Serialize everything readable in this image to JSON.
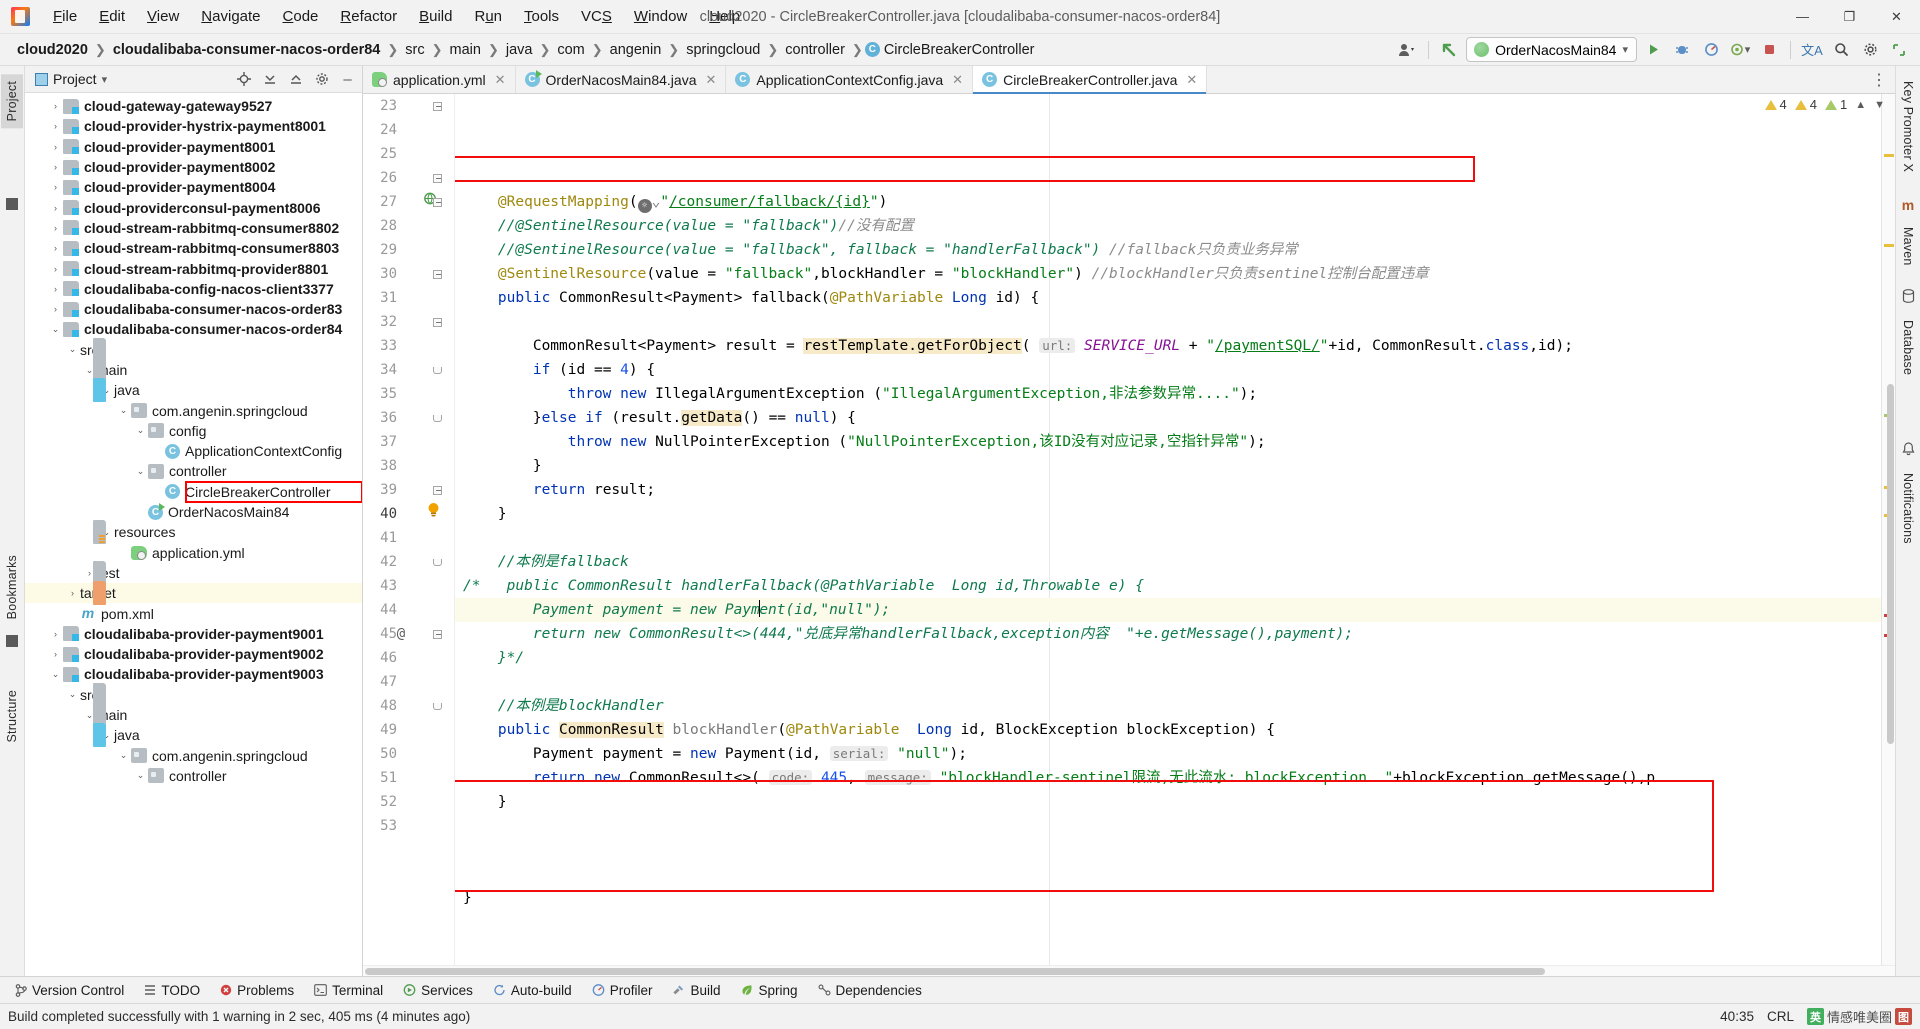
{
  "window": {
    "title": "cloud2020 - CircleBreakerController.java [cloudalibaba-consumer-nacos-order84]",
    "minimize": "—",
    "maximize": "❐",
    "close": "✕"
  },
  "menubar": [
    {
      "label": "File"
    },
    {
      "label": "Edit"
    },
    {
      "label": "View"
    },
    {
      "label": "Navigate"
    },
    {
      "label": "Code"
    },
    {
      "label": "Refactor"
    },
    {
      "label": "Build"
    },
    {
      "label": "Run"
    },
    {
      "label": "Tools"
    },
    {
      "label": "VCS"
    },
    {
      "label": "Window"
    },
    {
      "label": "Help"
    }
  ],
  "breadcrumbs": [
    {
      "label": "cloud2020",
      "bold": true
    },
    {
      "label": "cloudalibaba-consumer-nacos-order84",
      "bold": true
    },
    {
      "label": "src"
    },
    {
      "label": "main"
    },
    {
      "label": "java"
    },
    {
      "label": "com"
    },
    {
      "label": "angenin"
    },
    {
      "label": "springcloud"
    },
    {
      "label": "controller"
    },
    {
      "label": "CircleBreakerController",
      "icon": "C"
    }
  ],
  "toolbar_right": {
    "user_icon": "user-icon",
    "back_arrow": "↖",
    "run_config": "OrderNacosMain84",
    "run": "▶",
    "debug": "debug-icon",
    "profile": "profile-icon",
    "coverage": "coverage-icon",
    "stop": "■",
    "translate": "文A",
    "search": "⚲",
    "settings": "⚙"
  },
  "left_rail": [
    {
      "label": "Project",
      "selected": true
    },
    {
      "label": "Bookmarks",
      "selected": false
    },
    {
      "label": "Structure",
      "selected": false
    }
  ],
  "right_rail": [
    {
      "label": "Key Promoter X"
    },
    {
      "label": "Maven"
    },
    {
      "label": "Database"
    },
    {
      "label": "Notifications"
    }
  ],
  "project_panel": {
    "title": "Project",
    "dropdown": "▾",
    "actions": [
      "locate-icon",
      "expand-all-icon",
      "collapse-all-icon",
      "settings-icon",
      "hide-icon"
    ],
    "tree": [
      {
        "indent": 1,
        "arrow": "›",
        "icon": "mod",
        "label": "cloud-gateway-gateway9527",
        "bold": true
      },
      {
        "indent": 1,
        "arrow": "›",
        "icon": "mod",
        "label": "cloud-provider-hystrix-payment8001",
        "bold": true
      },
      {
        "indent": 1,
        "arrow": "›",
        "icon": "mod",
        "label": "cloud-provider-payment8001",
        "bold": true
      },
      {
        "indent": 1,
        "arrow": "›",
        "icon": "mod",
        "label": "cloud-provider-payment8002",
        "bold": true
      },
      {
        "indent": 1,
        "arrow": "›",
        "icon": "mod",
        "label": "cloud-provider-payment8004",
        "bold": true
      },
      {
        "indent": 1,
        "arrow": "›",
        "icon": "mod",
        "label": "cloud-providerconsul-payment8006",
        "bold": true
      },
      {
        "indent": 1,
        "arrow": "›",
        "icon": "mod",
        "label": "cloud-stream-rabbitmq-consumer8802",
        "bold": true
      },
      {
        "indent": 1,
        "arrow": "›",
        "icon": "mod",
        "label": "cloud-stream-rabbitmq-consumer8803",
        "bold": true
      },
      {
        "indent": 1,
        "arrow": "›",
        "icon": "mod",
        "label": "cloud-stream-rabbitmq-provider8801",
        "bold": true
      },
      {
        "indent": 1,
        "arrow": "›",
        "icon": "mod",
        "label": "cloudalibaba-config-nacos-client3377",
        "bold": true
      },
      {
        "indent": 1,
        "arrow": "›",
        "icon": "mod",
        "label": "cloudalibaba-consumer-nacos-order83",
        "bold": true
      },
      {
        "indent": 1,
        "arrow": "⌄",
        "icon": "mod",
        "label": "cloudalibaba-consumer-nacos-order84",
        "bold": true
      },
      {
        "indent": 2,
        "arrow": "⌄",
        "icon": "fold",
        "label": "src"
      },
      {
        "indent": 3,
        "arrow": "⌄",
        "icon": "fold",
        "label": "main"
      },
      {
        "indent": 4,
        "arrow": "⌄",
        "icon": "foldblue",
        "label": "java"
      },
      {
        "indent": 5,
        "arrow": "⌄",
        "icon": "pkg",
        "label": "com.angenin.springcloud"
      },
      {
        "indent": 6,
        "arrow": "⌄",
        "icon": "pkg",
        "label": "config"
      },
      {
        "indent": 7,
        "arrow": "",
        "icon": "cls",
        "label": "ApplicationContextConfig"
      },
      {
        "indent": 6,
        "arrow": "⌄",
        "icon": "pkg",
        "label": "controller"
      },
      {
        "indent": 7,
        "arrow": "",
        "icon": "cls",
        "label": "CircleBreakerController",
        "boxed": true
      },
      {
        "indent": 6,
        "arrow": "",
        "icon": "clsrun",
        "label": "OrderNacosMain84"
      },
      {
        "indent": 4,
        "arrow": "⌄",
        "icon": "foldres",
        "label": "resources"
      },
      {
        "indent": 5,
        "arrow": "",
        "icon": "yml",
        "label": "application.yml"
      },
      {
        "indent": 3,
        "arrow": "›",
        "icon": "fold",
        "label": "test"
      },
      {
        "indent": 2,
        "arrow": "›",
        "icon": "foldorange",
        "label": "target",
        "highlight": true
      },
      {
        "indent": 2,
        "arrow": "",
        "icon": "mvn",
        "label": "pom.xml"
      },
      {
        "indent": 1,
        "arrow": "›",
        "icon": "mod",
        "label": "cloudalibaba-provider-payment9001",
        "bold": true
      },
      {
        "indent": 1,
        "arrow": "›",
        "icon": "mod",
        "label": "cloudalibaba-provider-payment9002",
        "bold": true
      },
      {
        "indent": 1,
        "arrow": "⌄",
        "icon": "mod",
        "label": "cloudalibaba-provider-payment9003",
        "bold": true
      },
      {
        "indent": 2,
        "arrow": "⌄",
        "icon": "fold",
        "label": "src"
      },
      {
        "indent": 3,
        "arrow": "⌄",
        "icon": "fold",
        "label": "main"
      },
      {
        "indent": 4,
        "arrow": "⌄",
        "icon": "foldblue",
        "label": "java"
      },
      {
        "indent": 5,
        "arrow": "⌄",
        "icon": "pkg",
        "label": "com.angenin.springcloud"
      },
      {
        "indent": 6,
        "arrow": "⌄",
        "icon": "pkg",
        "label": "controller"
      }
    ]
  },
  "editor_tabs": [
    {
      "label": "application.yml",
      "icon": "yml",
      "active": false
    },
    {
      "label": "OrderNacosMain84.java",
      "icon": "clsrun",
      "active": false
    },
    {
      "label": "ApplicationContextConfig.java",
      "icon": "cls",
      "active": false
    },
    {
      "label": "CircleBreakerController.java",
      "icon": "cls",
      "active": true
    }
  ],
  "inspection": {
    "errors_icon": "warning-triangle",
    "counts": [
      "4",
      "4",
      "1"
    ],
    "chevron_up": "⌃",
    "chevron_down": "⌄"
  },
  "code": {
    "first_line": 23,
    "lines": [
      {
        "n": 23,
        "fold": "open"
      },
      {
        "n": 24
      },
      {
        "n": 25
      },
      {
        "n": 26,
        "fold": "open"
      },
      {
        "n": 27,
        "mark": "globe-run",
        "fold": "open"
      },
      {
        "n": 28
      },
      {
        "n": 29
      },
      {
        "n": 30,
        "fold": "open"
      },
      {
        "n": 31
      },
      {
        "n": 32,
        "fold": "open"
      },
      {
        "n": 33
      },
      {
        "n": 34,
        "fold": "close"
      },
      {
        "n": 35
      },
      {
        "n": 36,
        "fold": "close"
      },
      {
        "n": 37
      },
      {
        "n": 38
      },
      {
        "n": 39,
        "fold": "open"
      },
      {
        "n": 40,
        "mark": "bulb",
        "current": true
      },
      {
        "n": 41
      },
      {
        "n": 42,
        "fold": "close"
      },
      {
        "n": 43
      },
      {
        "n": 44
      },
      {
        "n": 45,
        "mark": "@",
        "fold": "open"
      },
      {
        "n": 46
      },
      {
        "n": 47
      },
      {
        "n": 48,
        "fold": "close"
      },
      {
        "n": 49
      },
      {
        "n": 50
      },
      {
        "n": 51
      },
      {
        "n": 52
      },
      {
        "n": 53
      }
    ],
    "text": {
      "l23": "@RequestMapping(ⓧ⌄\"/consumer/fallback/{id}\")",
      "l24": "//@SentinelResource(value = \"fallback\")//没有配置",
      "l25": "//@SentinelResource(value = \"fallback\", fallback = \"handlerFallback\") //fallback只负责业务异常",
      "l26": "@SentinelResource(value = \"fallback\",blockHandler = \"blockHandler\") //blockHandler只负责sentinel控制台配置违章",
      "l27": "public CommonResult<Payment> fallback(@PathVariable Long id) {",
      "l29": "CommonResult<Payment> result = restTemplate.getForObject( url: SERVICE_URL + \"/paymentSQL/\"+id, CommonResult.class,id);",
      "l30": "if (id == 4) {",
      "l31": "throw new IllegalArgumentException (\"IllegalArgumentException,非法参数异常....\");",
      "l32": "}else if (result.getData() == null) {",
      "l33": "throw new NullPointerException (\"NullPointerException,该ID没有对应记录,空指针异常\");",
      "l34": "}",
      "l35": "return result;",
      "l36": "}",
      "l38": "//本例是fallback",
      "l39": "/*   public CommonResult handlerFallback(@PathVariable  Long id,Throwable e) {",
      "l40": "Payment payment = new Payment(id,\"null\");",
      "l41": "return new CommonResult<>(444,\"兜底异常handlerFallback,exception内容  \"+e.getMessage(),payment);",
      "l42": "}*/",
      "l44": "//本例是blockHandler",
      "l45": "public CommonResult blockHandler(@PathVariable  Long id, BlockException blockException) {",
      "l46": "Payment payment = new Payment(id, serial: \"null\");",
      "l47": "return new CommonResult<>( code: 445, message: \"blockHandler-sentinel限流,无此流水: blockException  \"+blockException.getMessage(),p",
      "l48": "}",
      "l52": "}"
    }
  },
  "bottom_tools": [
    {
      "label": "Version Control",
      "icon": "branch-icon"
    },
    {
      "label": "TODO",
      "icon": "list-icon"
    },
    {
      "label": "Problems",
      "icon": "error-icon"
    },
    {
      "label": "Terminal",
      "icon": "terminal-icon"
    },
    {
      "label": "Services",
      "icon": "services-icon"
    },
    {
      "label": "Auto-build",
      "icon": "refresh-icon"
    },
    {
      "label": "Profiler",
      "icon": "gauge-icon"
    },
    {
      "label": "Build",
      "icon": "hammer-icon"
    },
    {
      "label": "Spring",
      "icon": "leaf-icon"
    },
    {
      "label": "Dependencies",
      "icon": "dependencies-icon"
    }
  ],
  "statusbar": {
    "message": "Build completed successfully with 1 warning in 2 sec, 405 ms (4 minutes ago)",
    "caret": "40:35",
    "line_sep": "CRL",
    "watermark1": "英",
    "watermark2": "情感唯美圈",
    "watermark3": "图"
  },
  "colors": {
    "accent": "#4a88c7",
    "annotation_red": "#f20d0d",
    "string_green": "#067d17",
    "keyword_blue": "#0033b3",
    "comment_grey": "#8c8c8c",
    "comment_green": "#0f7a4d",
    "annot_gold": "#9e880d",
    "number_blue": "#1750eb",
    "static_purple": "#871094"
  }
}
